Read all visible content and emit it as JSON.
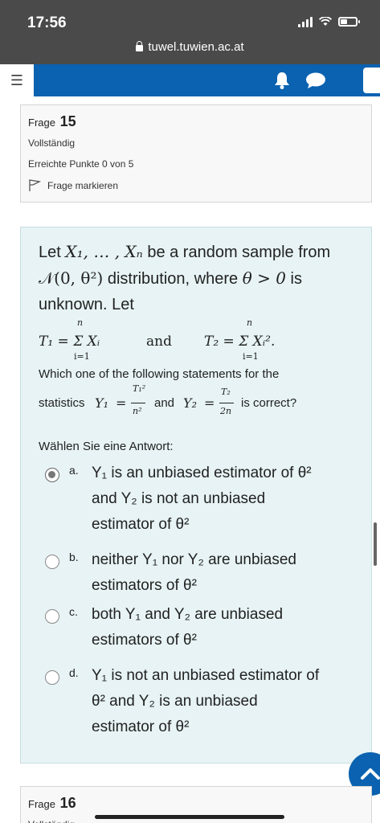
{
  "status_bar": {
    "time": "17:56",
    "url": "tuwel.tuwien.ac.at"
  },
  "navbar": {
    "menu_icon": "hamburger-icon",
    "notifications_icon": "bell-icon",
    "messages_icon": "chat-bubble-icon",
    "brand_color": "#0a62b0"
  },
  "question_info": {
    "label": "Frage",
    "number": "15",
    "state": "Vollständig",
    "points": "Erreichte Punkte 0 von 5",
    "flag_label": "Frage markieren"
  },
  "question": {
    "intro_word_1": "Let",
    "intro_seq": "X₁, … , Xₙ",
    "intro_rest_1": "be a random sample from",
    "dist": "𝒩(0, θ²)",
    "intro_rest_2": "distribution, where",
    "cond": "θ > 0",
    "intro_rest_3": "is unknown. Let",
    "t1": "T₁ = Σ Xᵢ",
    "and_word": "and",
    "t2": "T₂ = Σ Xᵢ².",
    "sum_upper": "n",
    "sum_lower": "i=1",
    "statement_line1": "Which one of the following statements for the",
    "statement_word": "statistics",
    "y1_lhs": "Y₁",
    "y1_num": "T₁²",
    "y1_den": "n²",
    "and_inline": "and",
    "y2_lhs": "Y₂",
    "y2_num": "T₂",
    "y2_den": "2n",
    "is_correct": "is correct?",
    "choose_label": "Wählen Sie eine Antwort:"
  },
  "options": [
    {
      "letter": "a.",
      "text_1": "Y₁ is an unbiased estimator of θ²",
      "text_2": "and Y₂ is not an unbiased",
      "text_3": "estimator of θ²",
      "checked": true
    },
    {
      "letter": "b.",
      "text_1": "neither Y₁ nor Y₂ are unbiased",
      "text_2": "estimators of θ²",
      "checked": false
    },
    {
      "letter": "c.",
      "text_1": "both Y₁ and Y₂ are unbiased",
      "text_2": "estimators of θ²",
      "checked": false
    },
    {
      "letter": "d.",
      "text_1": "Y₁ is not an unbiased estimator of",
      "text_2": "θ² and Y₂ is an unbiased",
      "text_3": "estimator of θ²",
      "checked": false
    }
  ],
  "next_question": {
    "label": "Frage",
    "number": "16",
    "state": "Vollständig"
  }
}
